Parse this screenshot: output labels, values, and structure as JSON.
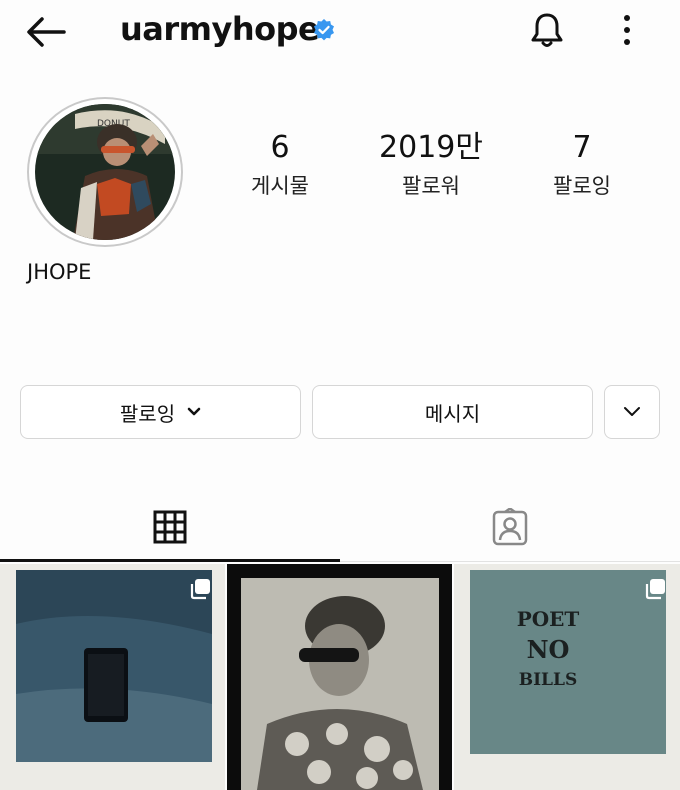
{
  "header": {
    "username": "uarmyhope",
    "icons": {
      "back": "arrow-left-icon",
      "verified": "verified-badge-icon",
      "notifications": "bell-icon",
      "more": "more-vertical-icon"
    },
    "accent_color": "#3897f0"
  },
  "profile": {
    "display_name": "JHOPE",
    "stats": [
      {
        "value": "6",
        "label": "게시물"
      },
      {
        "value": "2019만",
        "label": "팔로워"
      },
      {
        "value": "7",
        "label": "팔로잉"
      }
    ]
  },
  "actions": {
    "follow_label": "팔로잉",
    "message_label": "메시지"
  },
  "tabs": [
    {
      "icon": "grid-icon",
      "selected": true
    },
    {
      "icon": "tagged-person-icon",
      "selected": false
    }
  ],
  "posts": [
    {
      "subject": "phone-on-sand-photo",
      "multi": true
    },
    {
      "subject": "portrait-photo",
      "multi": false
    },
    {
      "subject": "poet-no-bills-sign-photo",
      "multi": true,
      "sign_lines": [
        "POET",
        "NO",
        "BILLS"
      ]
    }
  ]
}
